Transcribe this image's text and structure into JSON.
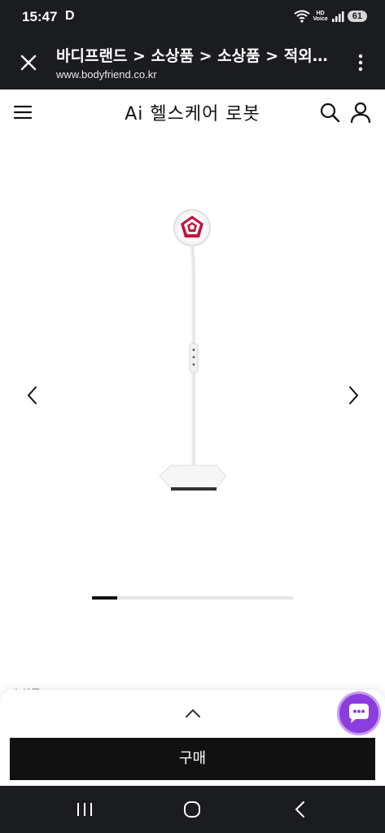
{
  "status_bar": {
    "time": "15:47",
    "notification_letter": "D",
    "hd_voice_top": "HD",
    "hd_voice_bottom": "Voice",
    "battery": "61"
  },
  "tab_header": {
    "title": "바디프랜드 > 소상품 > 소상품 > 적외선...",
    "url": "www.bodyfriend.co.kr"
  },
  "site_nav": {
    "logo": "Ai 헬스케어 로봇"
  },
  "gallery": {
    "progress_fraction": 0.125
  },
  "peek_text": "소상품",
  "bottom_sheet": {
    "buy_label": "구매"
  },
  "colors": {
    "dark_bar": "#1b1c20",
    "buy_button": "#111111",
    "chat_fab": "#8b3dde",
    "lamp_accent": "#c0183c"
  },
  "icons": {
    "close": "close-icon",
    "more": "more-vertical-icon",
    "menu": "hamburger-icon",
    "search": "search-icon",
    "user": "user-icon",
    "prev": "chevron-left-icon",
    "next": "chevron-right-icon",
    "expand": "chevron-up-icon",
    "chat": "chat-bubble-icon",
    "recent_apps": "recent-apps-icon",
    "home": "home-icon",
    "back": "back-icon"
  }
}
